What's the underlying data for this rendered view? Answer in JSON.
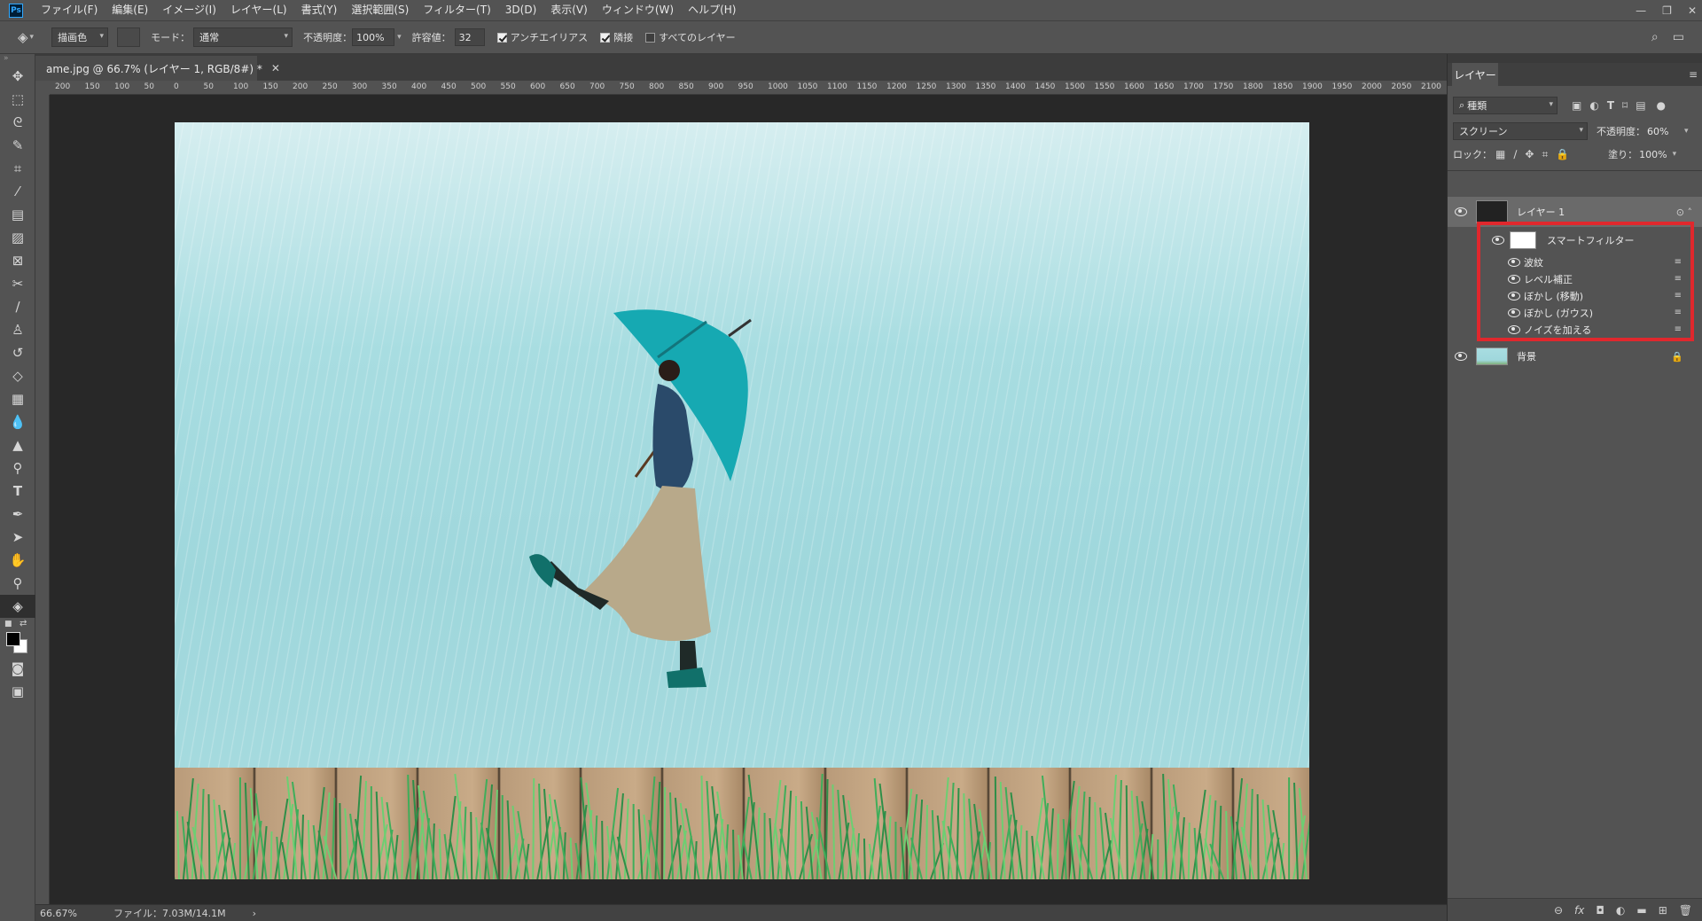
{
  "menubar": {
    "logo": "Ps",
    "items": [
      "ファイル(F)",
      "編集(E)",
      "イメージ(I)",
      "レイヤー(L)",
      "書式(Y)",
      "選択範囲(S)",
      "フィルター(T)",
      "3D(D)",
      "表示(V)",
      "ウィンドウ(W)",
      "ヘルプ(H)"
    ],
    "window_controls": [
      "minimize-icon",
      "restore-icon",
      "close-icon"
    ]
  },
  "options": {
    "tool_icon": "paint-bucket-icon",
    "fill_source": "描画色",
    "mode_label": "モード：",
    "mode_value": "通常",
    "opacity_label": "不透明度：",
    "opacity_value": "100%",
    "tolerance_label": "許容値：",
    "tolerance_value": "32",
    "antialias_label": "アンチエイリアス",
    "antialias_checked": true,
    "contiguous_label": "隣接",
    "contiguous_checked": true,
    "all_layers_label": "すべてのレイヤー",
    "all_layers_checked": false
  },
  "tools": [
    "move-icon",
    "marquee-icon",
    "lasso-icon",
    "quick-select-icon",
    "crop-icon",
    "eyedropper-icon",
    "ruler-icon",
    "healing-icon",
    "frame-icon",
    "content-aware-move-icon",
    "brush-icon",
    "clone-stamp-icon",
    "history-brush-icon",
    "eraser-icon",
    "gradient-icon",
    "blur-icon",
    "sharpen-icon",
    "dodge-icon",
    "type-icon",
    "pen-icon",
    "path-select-icon",
    "hand-icon",
    "zoom-icon",
    "paint-bucket-icon"
  ],
  "document": {
    "tab_title": "ame.jpg @ 66.7% (レイヤー 1, RGB/8#) *",
    "ruler_ticks": [
      "200",
      "150",
      "100",
      "50",
      "0",
      "50",
      "100",
      "150",
      "200",
      "250",
      "300",
      "350",
      "400",
      "450",
      "500",
      "550",
      "600",
      "650",
      "700",
      "750",
      "800",
      "850",
      "900",
      "950",
      "1000",
      "1050",
      "1100",
      "1150",
      "1200",
      "1250",
      "1300",
      "1350",
      "1400",
      "1450",
      "1500",
      "1550",
      "1600",
      "1650",
      "1700",
      "1750",
      "1800",
      "1850",
      "1900",
      "1950",
      "2000",
      "2050",
      "2100"
    ]
  },
  "status": {
    "zoom": "66.67%",
    "file_info": "ファイル：7.03M/14.1M",
    "arrow": "›"
  },
  "layers_panel": {
    "tab_label": "レイヤー",
    "filter_value": "種類",
    "blend_mode": "スクリーン",
    "opacity_label": "不透明度：",
    "opacity_value": "60%",
    "lock_label": "ロック：",
    "fill_label": "塗り：",
    "fill_value": "100%",
    "layers": [
      {
        "name": "レイヤー 1",
        "selected": true
      },
      {
        "name": "背景",
        "selected": false
      }
    ],
    "smart_filter_label": "スマートフィルター",
    "smart_filters": [
      "波紋",
      "レベル補正",
      "ぼかし (移動)",
      "ぼかし (ガウス)",
      "ノイズを加える"
    ],
    "highlight_color": "#e0282d"
  }
}
